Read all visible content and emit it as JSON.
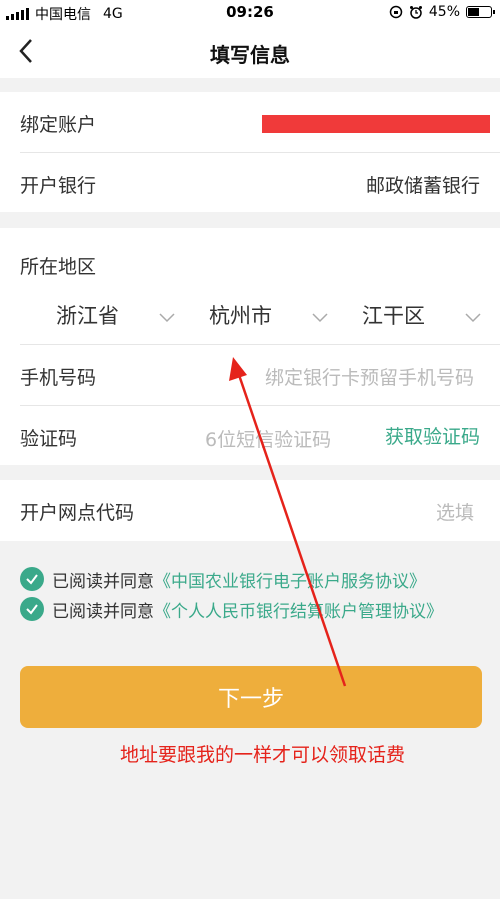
{
  "status_bar": {
    "carrier": "中国电信",
    "network": "4G",
    "time": "09:26",
    "battery": "45%",
    "battery_level": 0.45
  },
  "nav": {
    "title": "填写信息",
    "back_icon": "chevron-left-icon"
  },
  "account_card": {
    "bound_account_label": "绑定账户",
    "bank_label": "开户银行",
    "bank_value": "邮政储蓄银行"
  },
  "region_card": {
    "region_label": "所在地区",
    "province": "浙江省",
    "city": "杭州市",
    "district": "江干区",
    "phone_label": "手机号码",
    "phone_placeholder": "绑定银行卡预留手机号码",
    "code_label": "验证码",
    "code_placeholder": "6位短信验证码",
    "get_code": "获取验证码"
  },
  "branch": {
    "label": "开户网点代码",
    "placeholder": "选填"
  },
  "agreements": [
    {
      "prefix": "已阅读并同意",
      "link": "《中国农业银行电子账户服务协议》"
    },
    {
      "prefix": "已阅读并同意",
      "link": "《个人人民币银行结算账户管理协议》"
    }
  ],
  "next_button": "下一步",
  "annotation": "地址要跟我的一样才可以领取话费",
  "colors": {
    "accent_green": "#3aa98a",
    "button_orange": "#eeae3c",
    "annotation_red": "#e5231b"
  }
}
